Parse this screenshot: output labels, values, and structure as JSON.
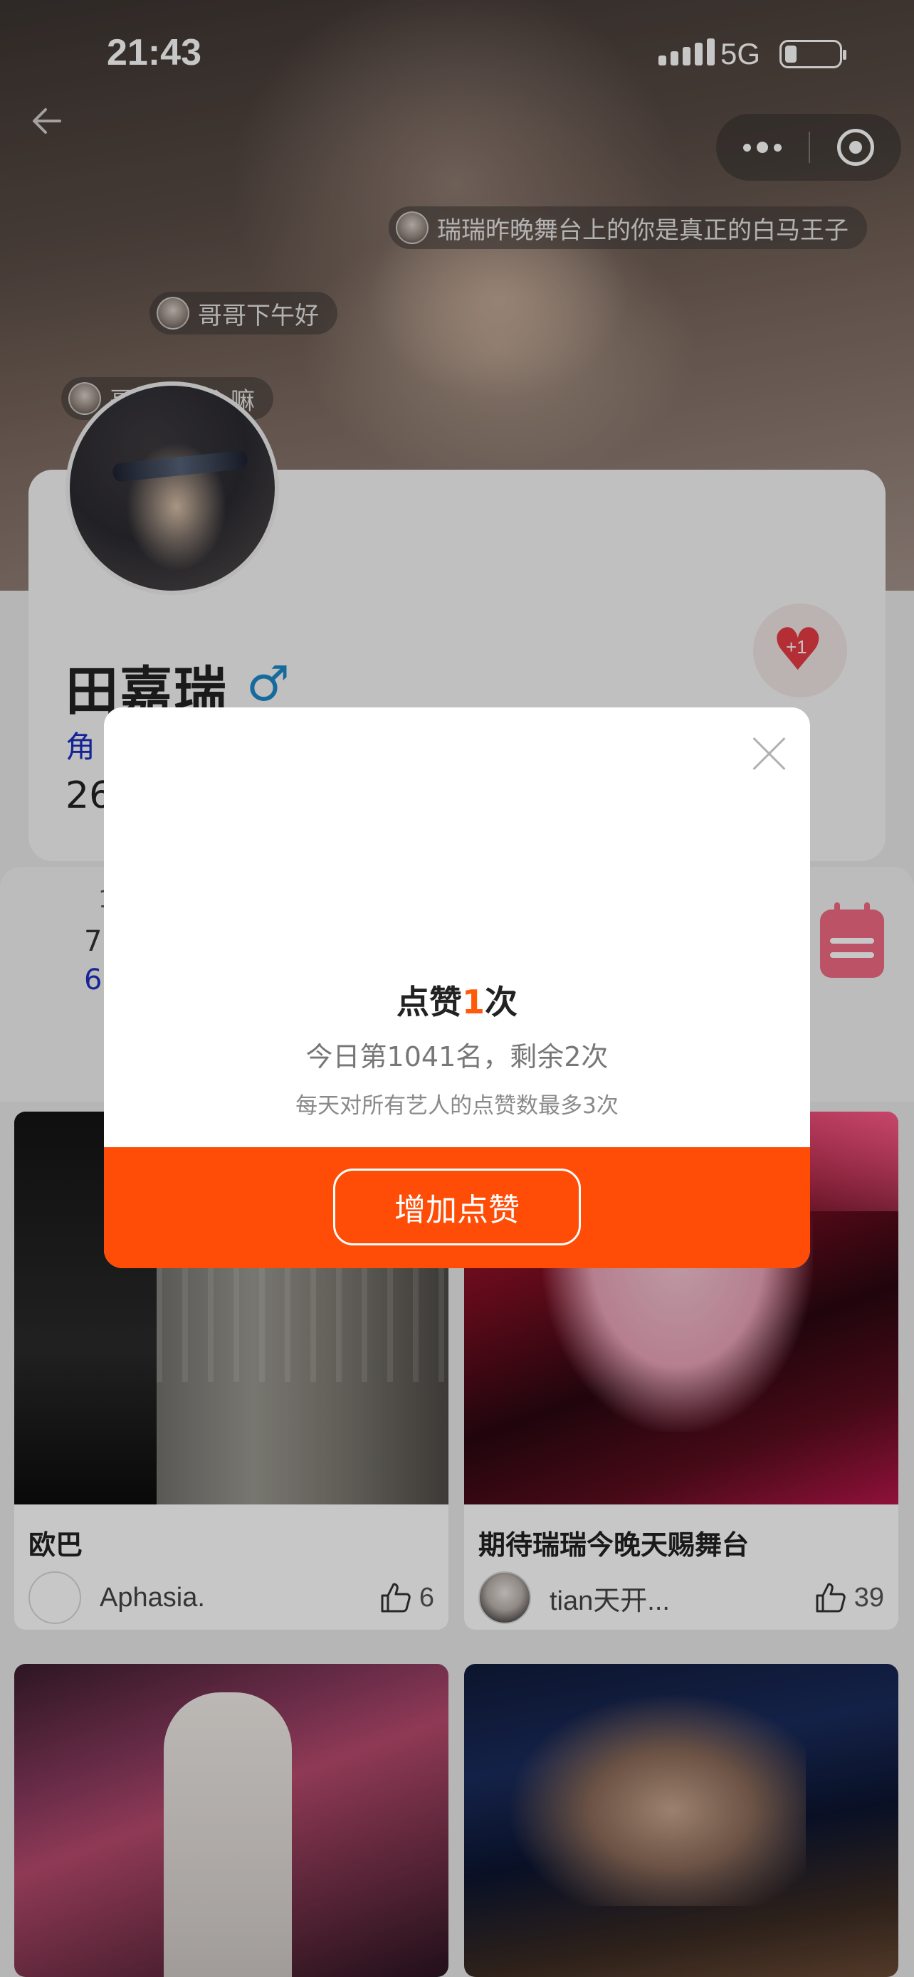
{
  "status_bar": {
    "time": "21:43",
    "network": "5G"
  },
  "danmu": [
    {
      "text": "瑞瑞昨晚舞台上的你是真正的白马王子"
    },
    {
      "text": "哥哥下午好"
    },
    {
      "text": "哥哥要开心嘛"
    }
  ],
  "profile": {
    "name": "田嘉瑞",
    "gender_symbol": "♂",
    "role_label": "角",
    "count_label": "26",
    "like_badge": "+1"
  },
  "rank_strip": {
    "top": "1",
    "line1": "7",
    "line2": "6"
  },
  "modal": {
    "title_prefix": "点赞",
    "title_count": "1",
    "title_suffix": "次",
    "rank_text": "今日第1041名，剩余2次",
    "note_text": "每天对所有艺人的点赞数最多3次",
    "button_label": "增加点赞"
  },
  "feed": [
    {
      "title": "欧巴",
      "author": "Aphasia.",
      "likes": "6"
    },
    {
      "title": "期待瑞瑞今晚天赐舞台",
      "author": "tian天开...",
      "likes": "39"
    },
    {
      "title": "",
      "author": "",
      "likes": ""
    },
    {
      "title": "",
      "author": "",
      "likes": ""
    }
  ],
  "colors": {
    "accent": "#ff4c06",
    "title_highlight": "#ff5a0a",
    "gender": "#1e88c8",
    "heart": "#e63b45"
  }
}
